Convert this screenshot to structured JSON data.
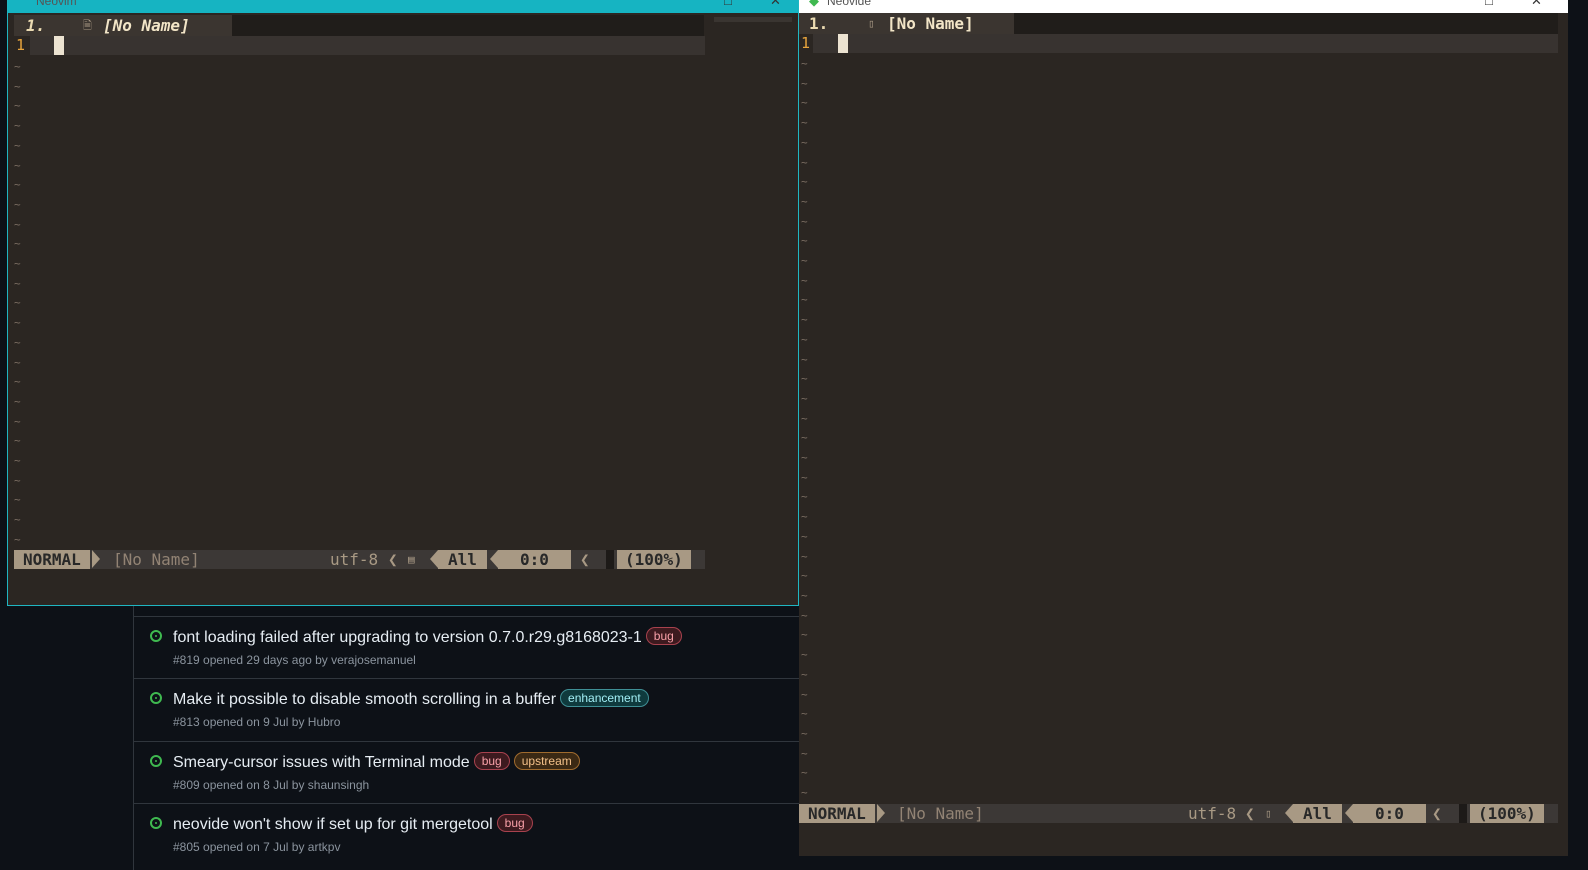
{
  "left_window": {
    "title": "Neovim",
    "tab": {
      "number": "1.",
      "name": "[No Name]"
    },
    "line_number": "1",
    "statusline": {
      "mode": "NORMAL",
      "filename": "[No Name]",
      "encoding": "utf-8",
      "scroll": "All",
      "position": "0:0",
      "percent": "(100%)"
    }
  },
  "right_window": {
    "title": "Neovide",
    "tab": {
      "number": "1.",
      "name": "[No Name]"
    },
    "line_number": "1",
    "statusline": {
      "mode": "NORMAL",
      "filename": "[No Name]",
      "encoding": "utf-8",
      "scroll": "All",
      "position": "0:0",
      "percent": "(100%)"
    }
  },
  "issues": [
    {
      "title": "font loading failed after upgrading to version 0.7.0.r29.g8168023-1",
      "labels": [
        "bug"
      ],
      "meta": "#819 opened 29 days ago by verajosemanuel"
    },
    {
      "title": "Make it possible to disable smooth scrolling in a buffer",
      "labels": [
        "enhancement"
      ],
      "meta": "#813 opened on 9 Jul by Hubro"
    },
    {
      "title": "Smeary-cursor issues with Terminal mode",
      "labels": [
        "bug",
        "upstream"
      ],
      "meta": "#809 opened on 8 Jul by shaunsingh"
    },
    {
      "title": "neovide won't show if set up for git mergetool",
      "labels": [
        "bug"
      ],
      "meta": "#805 opened on 7 Jul by artkpv"
    }
  ],
  "colors": {
    "accent_border": "#1fb6c2",
    "editor_bg": "#2b2622",
    "line_number": "#e7a43c",
    "status_bg": "#a89984",
    "issue_open": "#3fb950"
  }
}
